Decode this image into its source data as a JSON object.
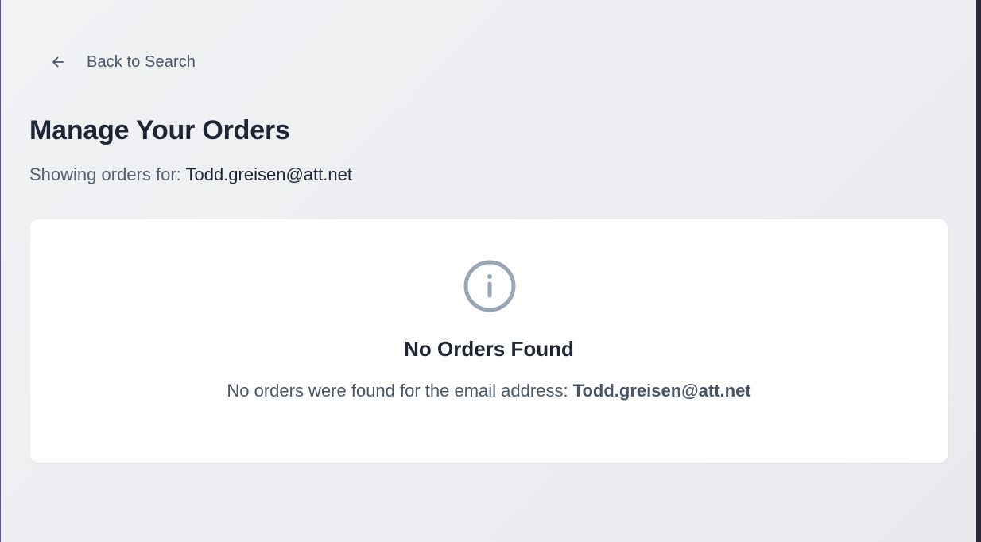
{
  "nav": {
    "back_label": "Back to Search",
    "back_icon": "arrow-left-icon"
  },
  "header": {
    "title": "Manage Your Orders",
    "subtitle_prefix": "Showing orders for:",
    "email": "Todd.greisen@att.net"
  },
  "empty_state": {
    "icon": "info-icon",
    "title": "No Orders Found",
    "message_prefix": "No orders were found for the email address:",
    "email": "Todd.greisen@att.net"
  },
  "colors": {
    "accent_border": "#5b4fb3",
    "text_primary": "#1e2535",
    "text_secondary": "#4a5568",
    "icon_gray": "#9aa5b8"
  }
}
